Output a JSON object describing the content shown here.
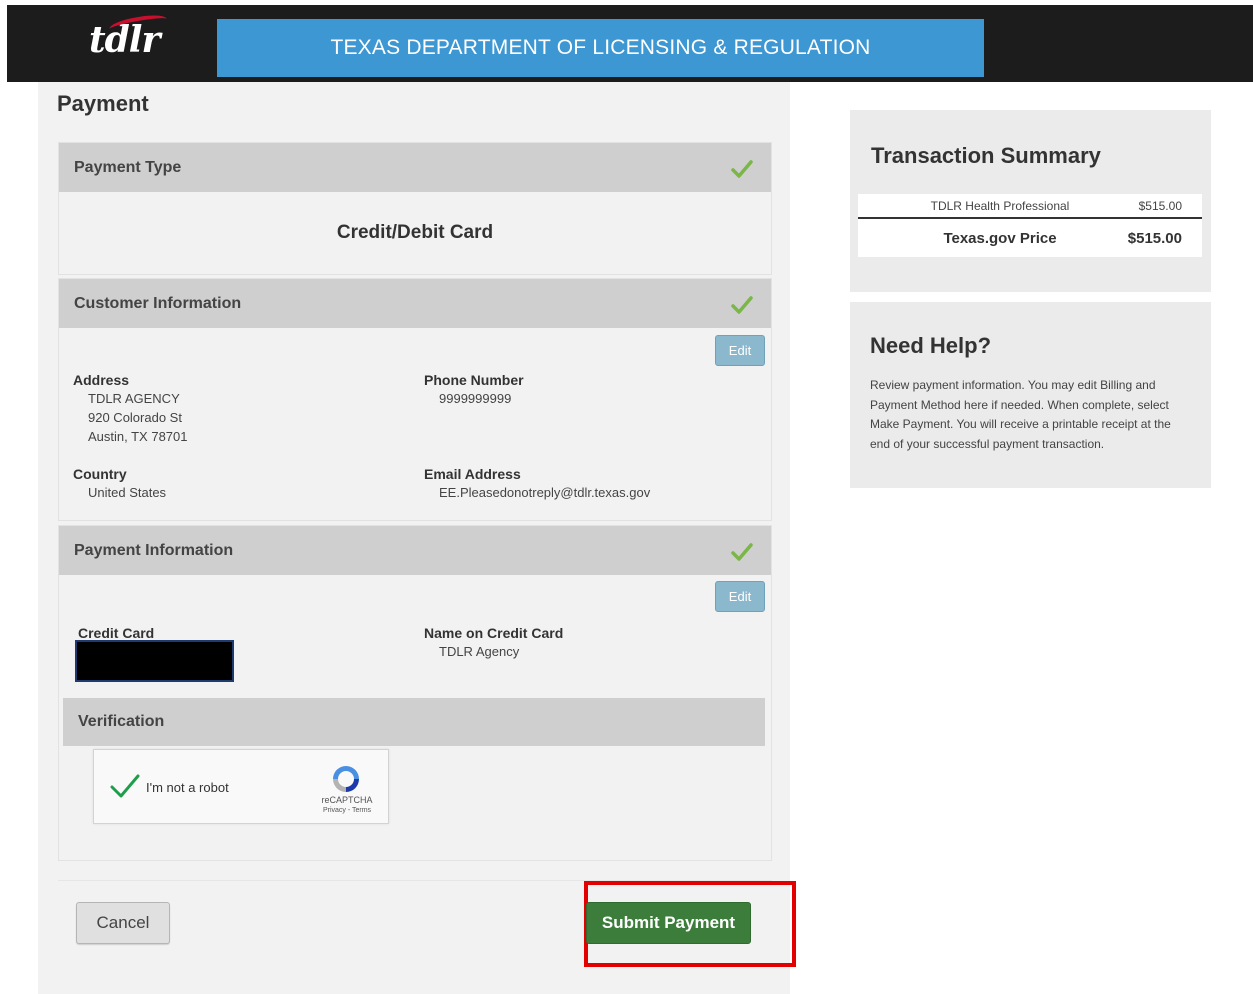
{
  "header": {
    "logo_text": "tdlr",
    "banner_title": "TEXAS DEPARTMENT OF LICENSING & REGULATION"
  },
  "page": {
    "title": "Payment"
  },
  "payment_type": {
    "heading": "Payment Type",
    "value": "Credit/Debit Card"
  },
  "customer_info": {
    "heading": "Customer Information",
    "edit_label": "Edit",
    "address_label": "Address",
    "address_lines": [
      "TDLR AGENCY",
      "920 Colorado St",
      "Austin, TX 78701"
    ],
    "phone_label": "Phone Number",
    "phone_value": "9999999999",
    "country_label": "Country",
    "country_value": "United States",
    "email_label": "Email Address",
    "email_value": "EE.Pleasedonotreply@tdlr.texas.gov"
  },
  "payment_info": {
    "heading": "Payment Information",
    "edit_label": "Edit",
    "cc_label": "Credit Card",
    "name_label": "Name on Credit Card",
    "name_value": "TDLR Agency"
  },
  "verification": {
    "heading": "Verification",
    "recaptcha_label": "I'm not a robot",
    "recaptcha_brand": "reCAPTCHA",
    "recaptcha_terms": "Privacy - Terms"
  },
  "actions": {
    "cancel_label": "Cancel",
    "submit_label": "Submit Payment"
  },
  "transaction_summary": {
    "title": "Transaction Summary",
    "item_name": "TDLR Health Professional",
    "item_amount": "$515.00",
    "total_label": "Texas.gov Price",
    "total_amount": "$515.00"
  },
  "help": {
    "title": "Need Help?",
    "text": "Review payment information. You may edit Billing and Payment Method here if needed. When complete, select Make Payment. You will receive a printable receipt at the end of your successful payment transaction."
  },
  "colors": {
    "banner": "#3c97d3",
    "header_bg": "#1c1c1c",
    "check_green": "#7ab648",
    "submit_green": "#3d7d3c",
    "highlight_red": "#e30000",
    "edit_blue": "#8cb8cd"
  },
  "icons": {
    "section_check": "checkmark-icon",
    "recaptcha_check": "green-checkmark-icon",
    "recaptcha_logo": "recaptcha-logo-icon"
  }
}
